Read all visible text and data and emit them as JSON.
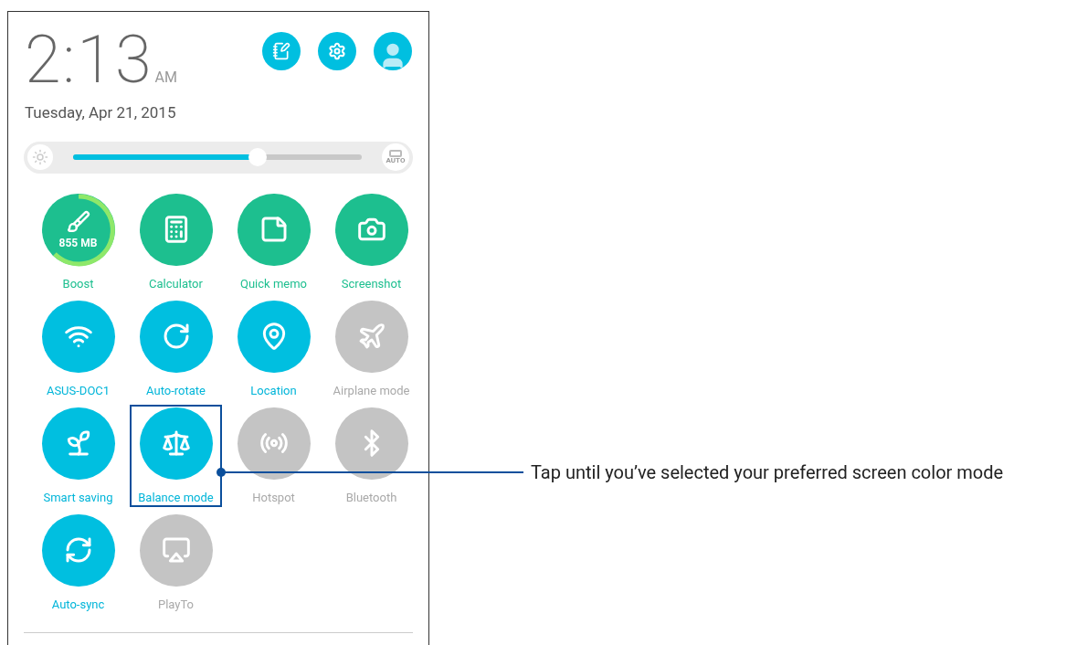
{
  "clock": {
    "time": "2:13",
    "meridiem": "AM",
    "date": "Tuesday, Apr 21, 2015"
  },
  "brightness": {
    "level": 0.64,
    "auto_label": "AUTO"
  },
  "tiles": [
    {
      "label": "Boost",
      "kind": "boost",
      "on": true,
      "highlighted": false,
      "badge": "855 MB"
    },
    {
      "label": "Calculator",
      "kind": "calculator",
      "on": true,
      "highlighted": false
    },
    {
      "label": "Quick memo",
      "kind": "memo",
      "on": true,
      "highlighted": false
    },
    {
      "label": "Screenshot",
      "kind": "screenshot",
      "on": true,
      "highlighted": false
    },
    {
      "label": "ASUS-DOC1",
      "kind": "wifi",
      "on": true,
      "highlighted": false
    },
    {
      "label": "Auto-rotate",
      "kind": "rotate",
      "on": true,
      "highlighted": false
    },
    {
      "label": "Location",
      "kind": "location",
      "on": true,
      "highlighted": false
    },
    {
      "label": "Airplane mode",
      "kind": "airplane",
      "on": false,
      "highlighted": false
    },
    {
      "label": "Smart saving",
      "kind": "leaf",
      "on": true,
      "highlighted": false
    },
    {
      "label": "Balance mode",
      "kind": "balance",
      "on": true,
      "highlighted": true
    },
    {
      "label": "Hotspot",
      "kind": "hotspot",
      "on": false,
      "highlighted": false
    },
    {
      "label": "Bluetooth",
      "kind": "bluetooth",
      "on": false,
      "highlighted": false
    },
    {
      "label": "Auto-sync",
      "kind": "sync",
      "on": true,
      "highlighted": false
    },
    {
      "label": "PlayTo",
      "kind": "playto",
      "on": false,
      "highlighted": false
    }
  ],
  "callout": {
    "text": "Tap until you’ve selected your preferred screen color mode"
  }
}
